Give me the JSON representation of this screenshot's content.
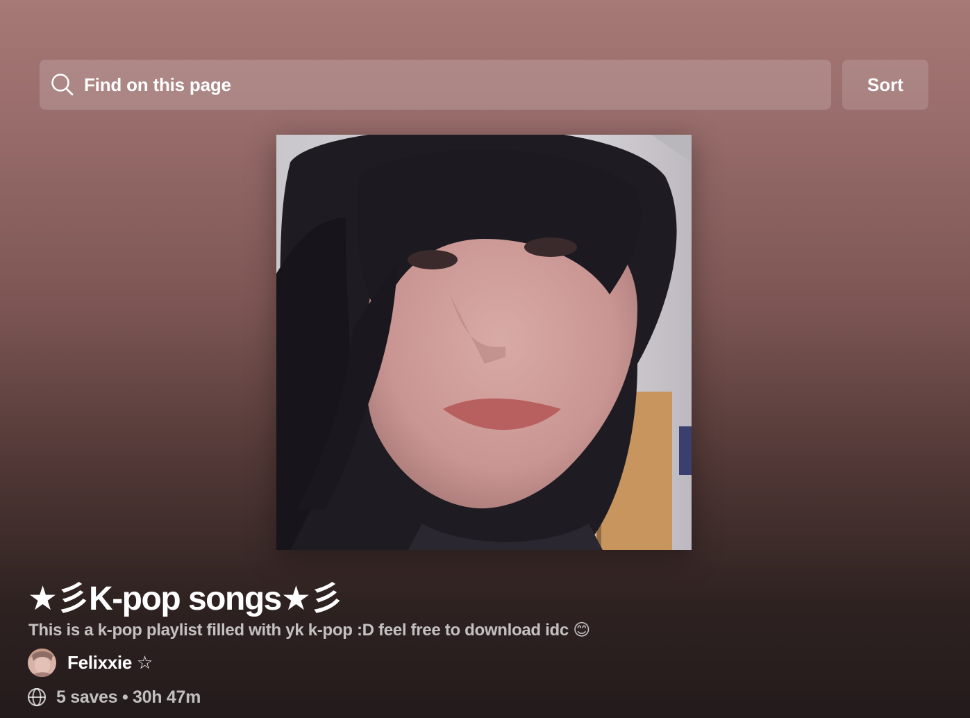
{
  "search": {
    "placeholder": "Find on this page",
    "icon": "search-icon"
  },
  "sort": {
    "label": "Sort"
  },
  "playlist": {
    "cover_alt": "playlist cover photo",
    "title": "★彡K-pop songs★彡",
    "description": "This is a k-pop playlist filled with yk k-pop :D feel free to download idc 😊",
    "owner": "Felixxie ☆",
    "visibility_icon": "globe-icon",
    "saves": "5 saves",
    "separator": "•",
    "duration": "30h 47m"
  },
  "colors": {
    "background_top": "#a67876",
    "background_bottom": "#231b1b",
    "text_primary": "#ffffff",
    "text_secondary": "rgba(255,255,255,0.72)"
  }
}
